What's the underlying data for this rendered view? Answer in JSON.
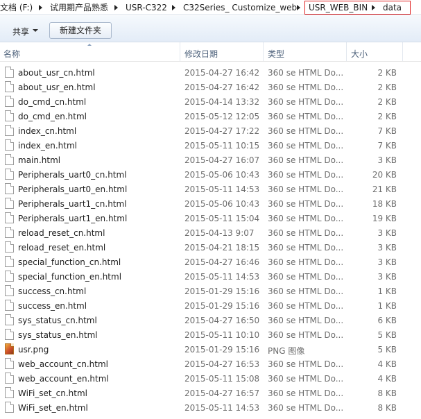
{
  "breadcrumb": {
    "items": [
      "文档 (F:)",
      "试用期产品熟悉",
      "USR-C322",
      "C32Series_ Customize_web",
      "USR_WEB_BIN",
      "data"
    ]
  },
  "toolbar": {
    "share_label": "共享",
    "new_folder_label": "新建文件夹"
  },
  "columns": {
    "name": "名称",
    "date": "修改日期",
    "type": "类型",
    "size": "大小"
  },
  "files": [
    {
      "name": "about_usr_cn.html",
      "date": "2015-04-27 16:42",
      "type": "360 se HTML Do...",
      "size": "2 KB",
      "icon": "html-file-icon"
    },
    {
      "name": "about_usr_en.html",
      "date": "2015-04-27 16:42",
      "type": "360 se HTML Do...",
      "size": "2 KB",
      "icon": "html-file-icon"
    },
    {
      "name": "do_cmd_cn.html",
      "date": "2015-04-14 13:32",
      "type": "360 se HTML Do...",
      "size": "2 KB",
      "icon": "html-file-icon"
    },
    {
      "name": "do_cmd_en.html",
      "date": "2015-05-12 12:05",
      "type": "360 se HTML Do...",
      "size": "2 KB",
      "icon": "html-file-icon"
    },
    {
      "name": "index_cn.html",
      "date": "2015-04-27 17:22",
      "type": "360 se HTML Do...",
      "size": "7 KB",
      "icon": "html-file-icon"
    },
    {
      "name": "index_en.html",
      "date": "2015-05-11 10:15",
      "type": "360 se HTML Do...",
      "size": "7 KB",
      "icon": "html-file-icon"
    },
    {
      "name": "main.html",
      "date": "2015-04-27 16:07",
      "type": "360 se HTML Do...",
      "size": "3 KB",
      "icon": "html-file-icon"
    },
    {
      "name": "Peripherals_uart0_cn.html",
      "date": "2015-05-06 10:43",
      "type": "360 se HTML Do...",
      "size": "20 KB",
      "icon": "html-file-icon"
    },
    {
      "name": "Peripherals_uart0_en.html",
      "date": "2015-05-11 14:53",
      "type": "360 se HTML Do...",
      "size": "21 KB",
      "icon": "html-file-icon"
    },
    {
      "name": "Peripherals_uart1_cn.html",
      "date": "2015-05-06 10:43",
      "type": "360 se HTML Do...",
      "size": "18 KB",
      "icon": "html-file-icon"
    },
    {
      "name": "Peripherals_uart1_en.html",
      "date": "2015-05-11 15:04",
      "type": "360 se HTML Do...",
      "size": "19 KB",
      "icon": "html-file-icon"
    },
    {
      "name": "reload_reset_cn.html",
      "date": "2015-04-13 9:07",
      "type": "360 se HTML Do...",
      "size": "3 KB",
      "icon": "html-file-icon"
    },
    {
      "name": "reload_reset_en.html",
      "date": "2015-04-21 18:15",
      "type": "360 se HTML Do...",
      "size": "3 KB",
      "icon": "html-file-icon"
    },
    {
      "name": "special_function_cn.html",
      "date": "2015-04-27 16:46",
      "type": "360 se HTML Do...",
      "size": "3 KB",
      "icon": "html-file-icon"
    },
    {
      "name": "special_function_en.html",
      "date": "2015-05-11 14:53",
      "type": "360 se HTML Do...",
      "size": "3 KB",
      "icon": "html-file-icon"
    },
    {
      "name": "success_cn.html",
      "date": "2015-01-29 15:16",
      "type": "360 se HTML Do...",
      "size": "1 KB",
      "icon": "html-file-icon"
    },
    {
      "name": "success_en.html",
      "date": "2015-01-29 15:16",
      "type": "360 se HTML Do...",
      "size": "1 KB",
      "icon": "html-file-icon"
    },
    {
      "name": "sys_status_cn.html",
      "date": "2015-04-27 16:50",
      "type": "360 se HTML Do...",
      "size": "6 KB",
      "icon": "html-file-icon"
    },
    {
      "name": "sys_status_en.html",
      "date": "2015-05-11 10:10",
      "type": "360 se HTML Do...",
      "size": "5 KB",
      "icon": "html-file-icon"
    },
    {
      "name": "usr.png",
      "date": "2015-01-29 15:16",
      "type": "PNG 图像",
      "size": "5 KB",
      "icon": "png-image-icon"
    },
    {
      "name": "web_account_cn.html",
      "date": "2015-04-27 16:53",
      "type": "360 se HTML Do...",
      "size": "4 KB",
      "icon": "html-file-icon"
    },
    {
      "name": "web_account_en.html",
      "date": "2015-05-11 15:08",
      "type": "360 se HTML Do...",
      "size": "4 KB",
      "icon": "html-file-icon"
    },
    {
      "name": "WiFi_set_cn.html",
      "date": "2015-04-27 16:57",
      "type": "360 se HTML Do...",
      "size": "8 KB",
      "icon": "html-file-icon"
    },
    {
      "name": "WiFi_set_en.html",
      "date": "2015-05-11 14:53",
      "type": "360 se HTML Do...",
      "size": "8 KB",
      "icon": "html-file-icon"
    }
  ],
  "colors": {
    "highlight_border": "#e02020",
    "header_text": "#4c607a",
    "secondary_text": "#6d6d6d"
  }
}
